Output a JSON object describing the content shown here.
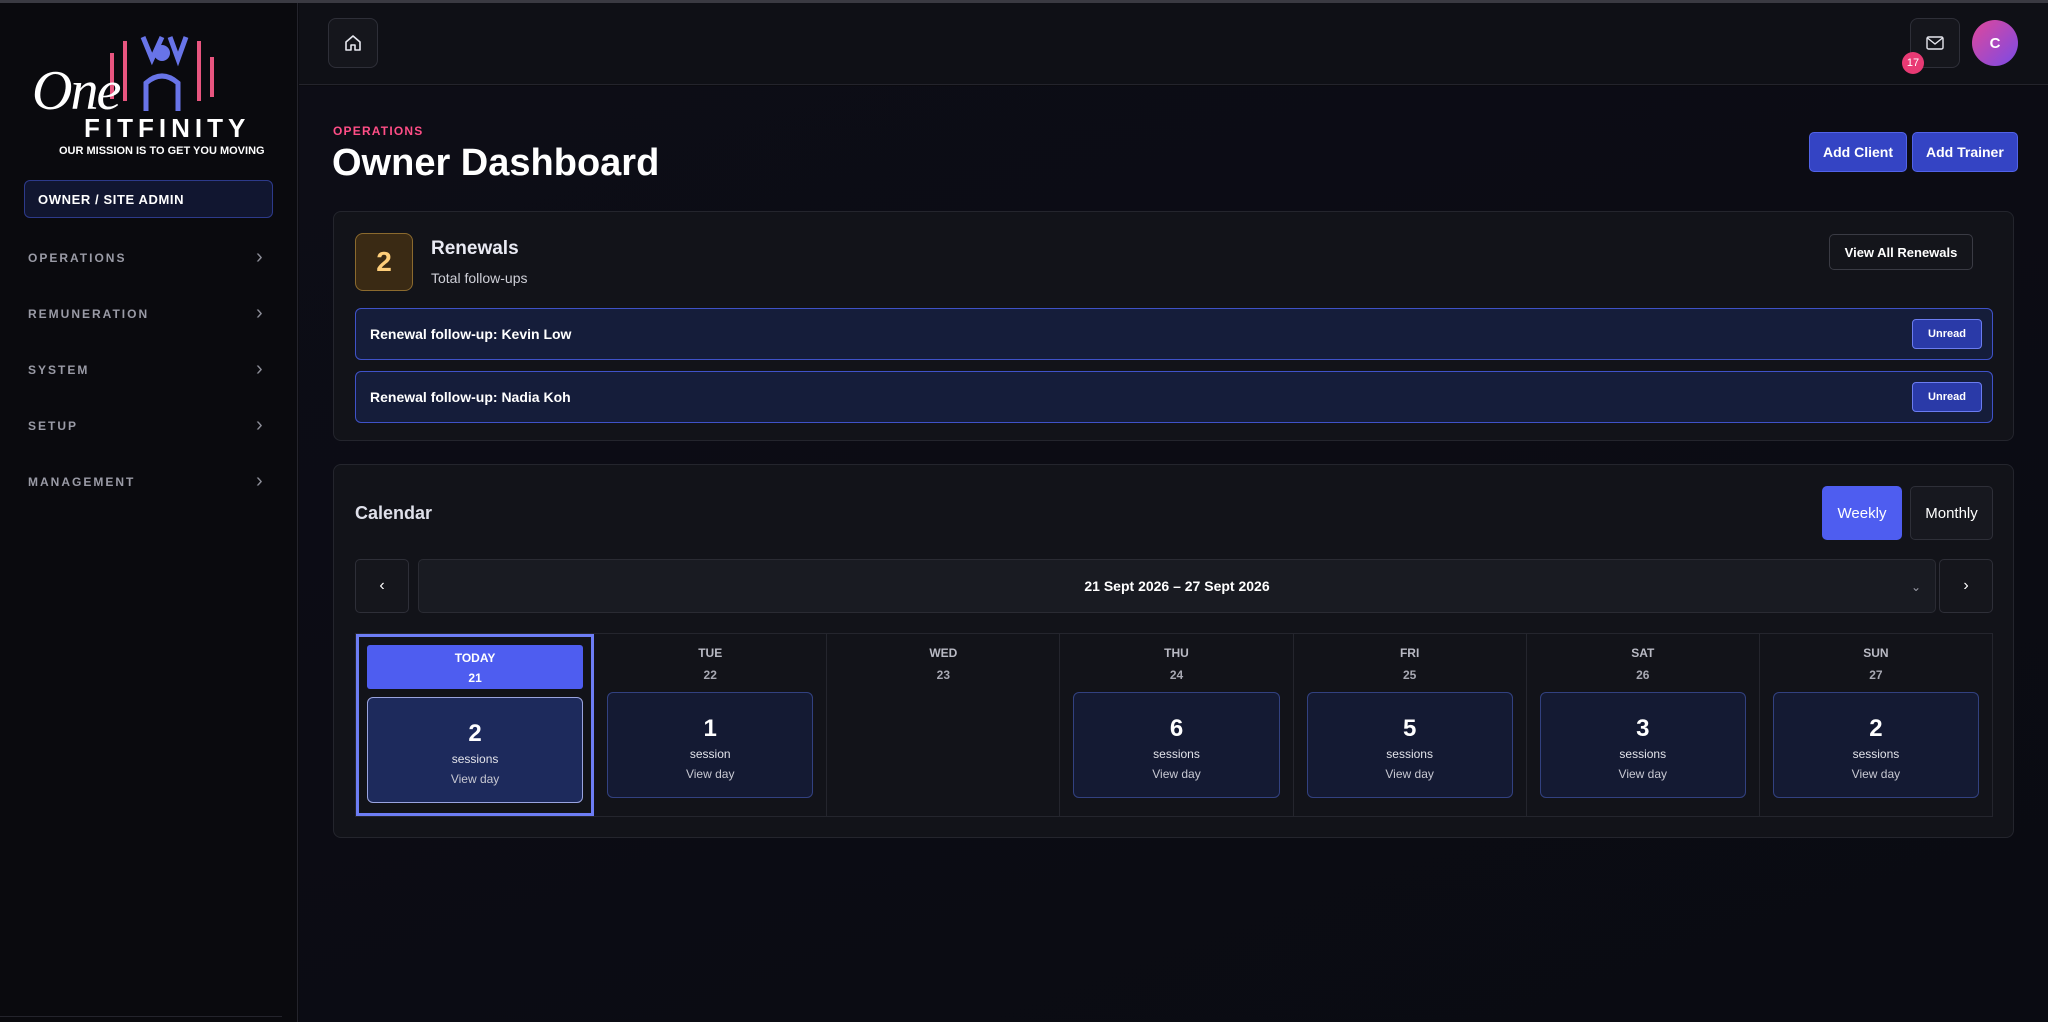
{
  "brand": {
    "logo_one": "One",
    "logo_word": "FITFINITY",
    "tagline": "OUR MISSION IS TO GET YOU MOVING",
    "accent_pink": "#e8557f",
    "accent_blue": "#4e5df0"
  },
  "sidebar": {
    "role": "OWNER / SITE ADMIN",
    "items": [
      {
        "label": "OPERATIONS"
      },
      {
        "label": "REMUNERATION"
      },
      {
        "label": "SYSTEM"
      },
      {
        "label": "SETUP"
      },
      {
        "label": "MANAGEMENT"
      }
    ]
  },
  "topbar": {
    "home_icon": "home-icon",
    "mail_icon": "mail-icon",
    "mail_count": "17",
    "avatar_initial": "C"
  },
  "header": {
    "eyebrow": "OPERATIONS",
    "title": "Owner Dashboard",
    "add_client": "Add Client",
    "add_trainer": "Add Trainer"
  },
  "renewals": {
    "count": "2",
    "title": "Renewals",
    "subtitle": "Total follow-ups",
    "view_all": "View All Renewals",
    "items": [
      {
        "text": "Renewal follow-up: Kevin Low",
        "status": "Unread"
      },
      {
        "text": "Renewal follow-up: Nadia Koh",
        "status": "Unread"
      }
    ]
  },
  "calendar": {
    "title": "Calendar",
    "weekly": "Weekly",
    "monthly": "Monthly",
    "prev": "‹",
    "next": "›",
    "range": "21 Sept 2026 – 27 Sept 2026",
    "caret": "⌄",
    "days": [
      {
        "name": "TODAY",
        "num": "21",
        "count": "2",
        "unit": "sessions",
        "link": "View day"
      },
      {
        "name": "TUE",
        "num": "22",
        "count": "1",
        "unit": "session",
        "link": "View day"
      },
      {
        "name": "WED",
        "num": "23"
      },
      {
        "name": "THU",
        "num": "24",
        "count": "6",
        "unit": "sessions",
        "link": "View day"
      },
      {
        "name": "FRI",
        "num": "25",
        "count": "5",
        "unit": "sessions",
        "link": "View day"
      },
      {
        "name": "SAT",
        "num": "26",
        "count": "3",
        "unit": "sessions",
        "link": "View day"
      },
      {
        "name": "SUN",
        "num": "27",
        "count": "2",
        "unit": "sessions",
        "link": "View day"
      }
    ]
  }
}
